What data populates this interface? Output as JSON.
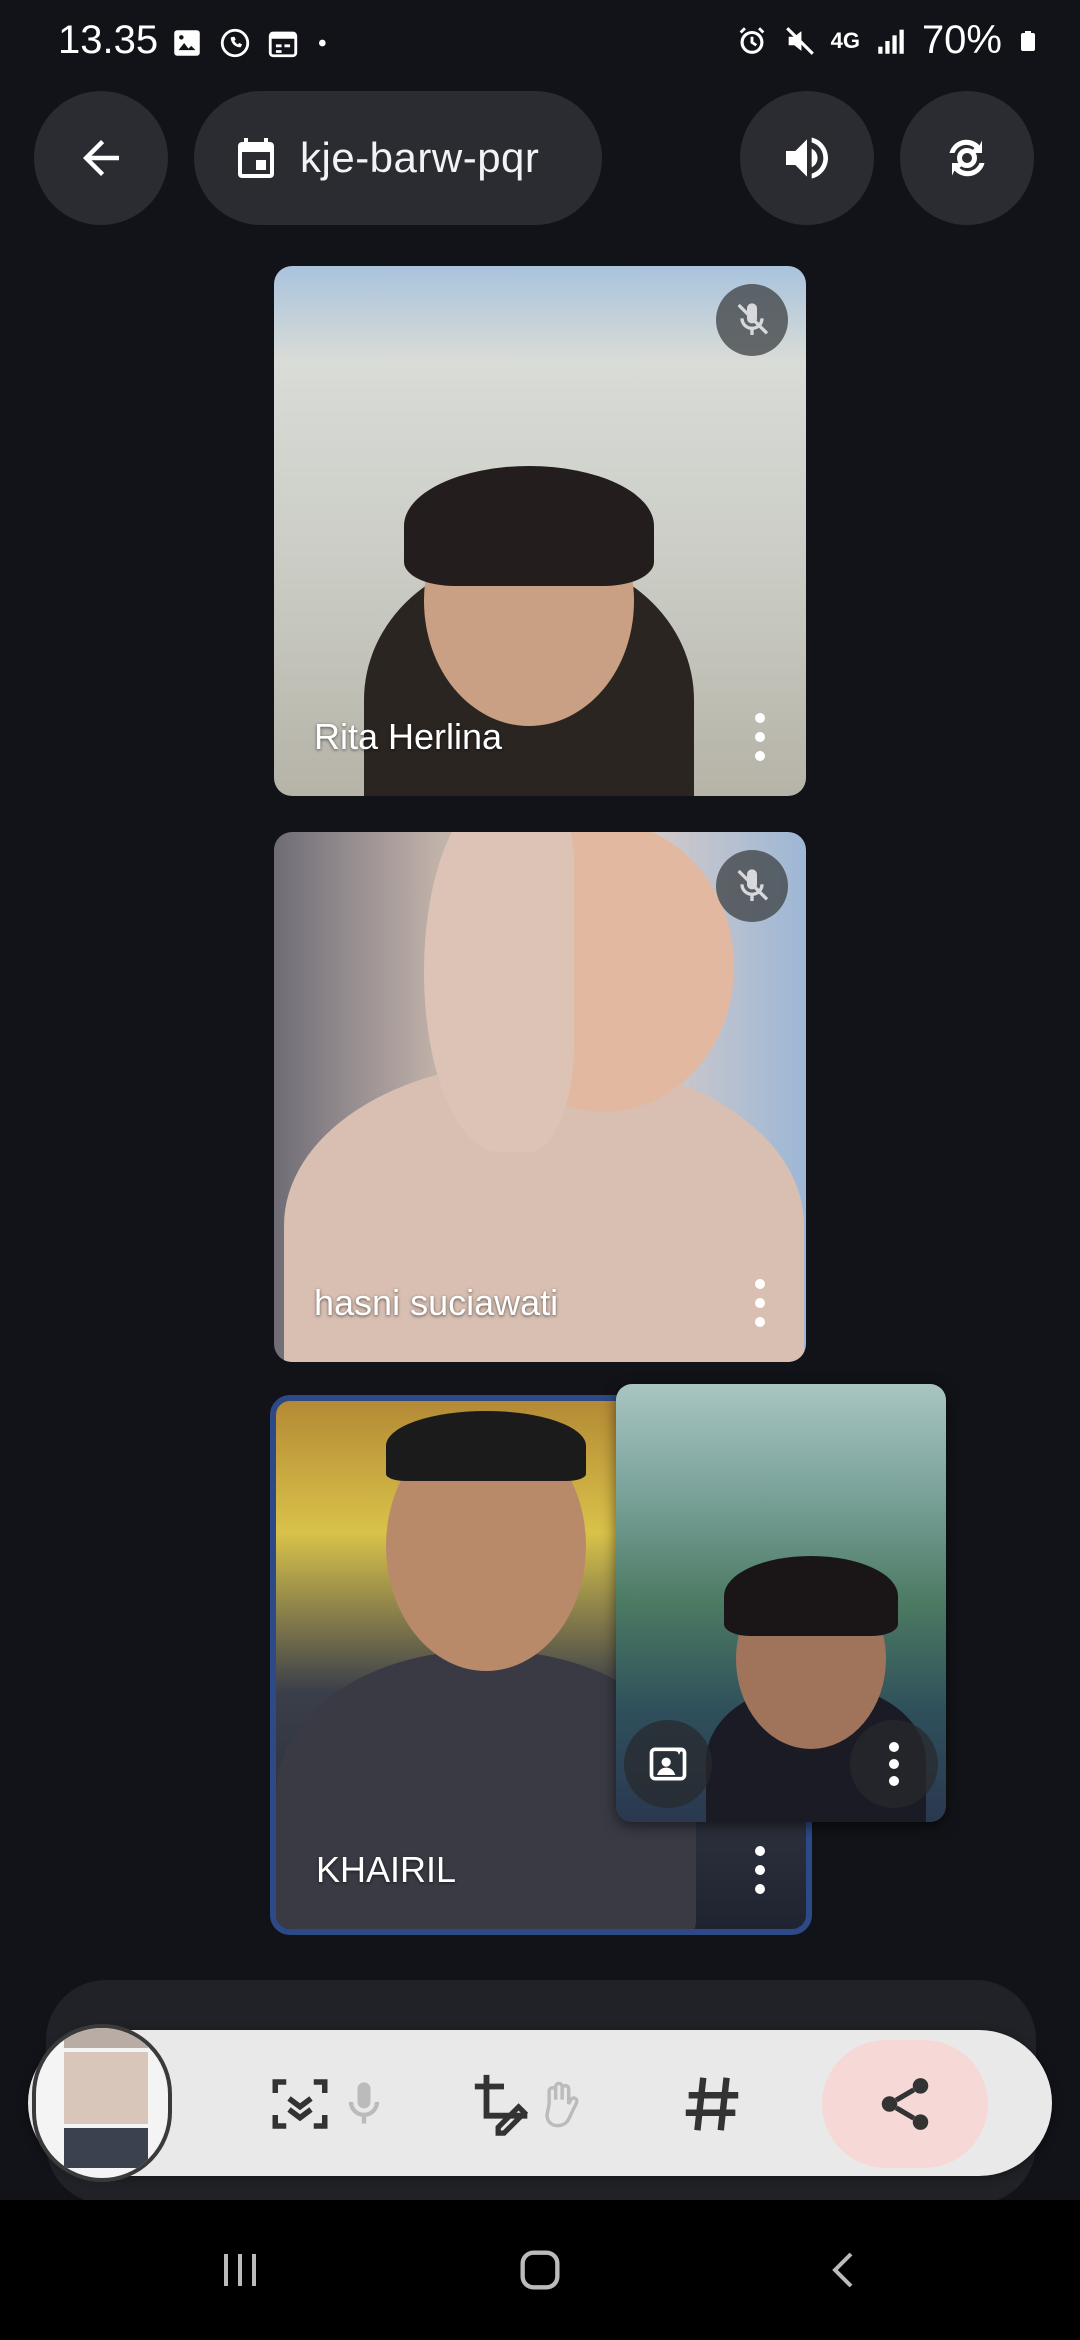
{
  "status_bar": {
    "time": "13.35",
    "network": "4G",
    "battery": "70%"
  },
  "top_bar": {
    "meeting_code": "kje-barw-pqr"
  },
  "participants": [
    {
      "name": "Rita Herlina",
      "muted": true
    },
    {
      "name": "hasni suciawati",
      "muted": true
    },
    {
      "name": "KHAIRIL",
      "muted": false,
      "highlighted": true
    }
  ],
  "colors": {
    "background": "#121318",
    "pill": "#2a2c31",
    "active_border": "#2d4a86",
    "share_accent": "#f6d8d6"
  },
  "icons": {
    "back": "arrow-left",
    "meeting": "calendar",
    "audio": "speaker",
    "camera_switch": "camera-flip",
    "share": "share"
  }
}
